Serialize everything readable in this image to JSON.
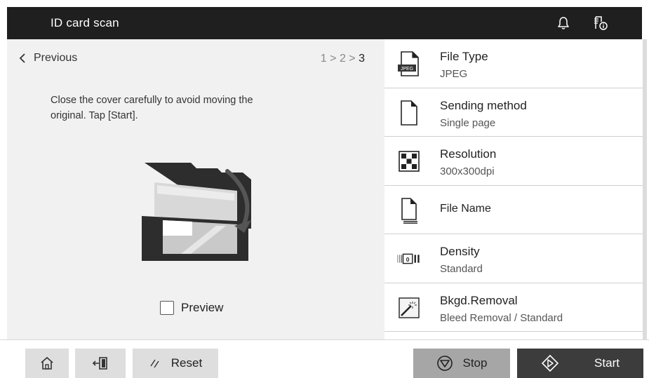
{
  "header": {
    "title": "ID card scan"
  },
  "left": {
    "previous_label": "Previous",
    "steps": {
      "step1": "1",
      "step2": "2",
      "step3": "3",
      "separator": ">"
    },
    "instruction": "Close the cover carefully to avoid moving the original. Tap [Start].",
    "preview_label": "Preview"
  },
  "settings": [
    {
      "label": "File Type",
      "value": "JPEG",
      "icon": "jpeg-file-icon"
    },
    {
      "label": "Sending method",
      "value": "Single page",
      "icon": "page-icon"
    },
    {
      "label": "Resolution",
      "value": "300x300dpi",
      "icon": "checker-icon"
    },
    {
      "label": "File Name",
      "value": "",
      "icon": "file-name-icon"
    },
    {
      "label": "Density",
      "value": "Standard",
      "icon": "density-icon"
    },
    {
      "label": "Bkgd.Removal",
      "value": "Bleed Removal / Standard",
      "icon": "bkgd-removal-icon"
    }
  ],
  "footer": {
    "reset_label": "Reset",
    "stop_label": "Stop",
    "start_label": "Start"
  },
  "icons": {
    "bell": "bell-icon",
    "job_info": "job-info-icon",
    "home": "home-icon",
    "logout": "logout-icon"
  }
}
